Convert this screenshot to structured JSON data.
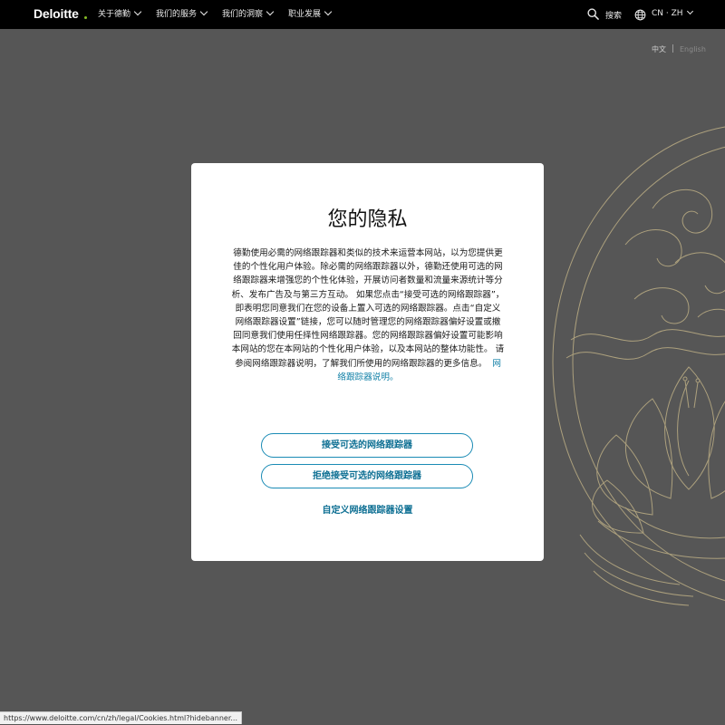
{
  "nav": {
    "logo": "Deloitte",
    "items": [
      "关于德勤",
      "我们的服务",
      "我们的洞察",
      "职业发展"
    ],
    "search_label": "搜索",
    "locale": "CN · ZH"
  },
  "lang_switch": {
    "current": "中文",
    "other": "English"
  },
  "modal": {
    "title": "您的隐私",
    "body": "德勤使用必需的网络跟踪器和类似的技术来运营本网站，以为您提供更佳的个性化用户体验。除必需的网络跟踪器以外，德勤还使用可选的网络跟踪器来增强您的个性化体验，开展访问者数量和流量来源统计等分析、发布广告及与第三方互动。 如果您点击“接受可选的网络跟踪器”，即表明您同意我们在您的设备上置入可选的网络跟踪器。点击“自定义网络跟踪器设置”链接，您可以随时管理您的网络跟踪器偏好设置或撤回同意我们使用任择性网络跟踪器。您的网络跟踪器偏好设置可能影响本网站的您在本网站的个性化用户体验，以及本网站的整体功能性。 请参阅网络跟踪器说明，了解我们所使用的网络跟踪器的更多信息。",
    "link": "网络跟踪器说明。",
    "accept_button": "接受可选的网络跟踪器",
    "reject_button": "拒绝接受可选的网络跟踪器",
    "customize_link": "自定义网络跟踪器设置"
  },
  "statusbar": {
    "url": "https://www.deloitte.com/cn/zh/legal/Cookies.html?hidebanner..."
  },
  "colors": {
    "nav_bg": "#000000",
    "page_bg": "#565656",
    "accent": "#0d6f93",
    "logo_dot": "#86bc25",
    "lotus_line": "#c9b98a"
  }
}
